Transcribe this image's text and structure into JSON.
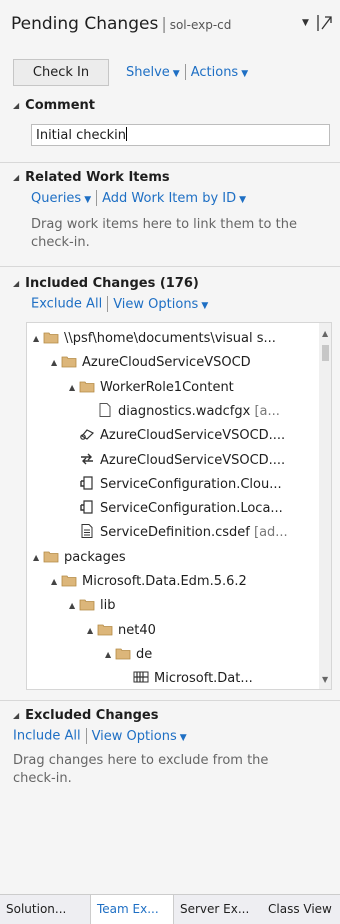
{
  "header": {
    "title": "Pending Changes",
    "separator": "|",
    "workspace": "sol-exp-cd"
  },
  "toolbar": {
    "checkin_label": "Check In",
    "shelve_label": "Shelve",
    "actions_label": "Actions"
  },
  "comment": {
    "heading": "Comment",
    "value": "Initial checkin"
  },
  "related": {
    "heading": "Related Work Items",
    "queries_label": "Queries",
    "add_label": "Add Work Item by ID",
    "help": "Drag work items here to link them to the check-in."
  },
  "included": {
    "heading": "Included Changes (176)",
    "exclude_all_label": "Exclude All",
    "view_options_label": "View Options",
    "tree": [
      {
        "indent": 0,
        "expander": "▲",
        "icon": "folder-icon",
        "label": "\\\\psf\\home\\documents\\visual s...",
        "suffix": ""
      },
      {
        "indent": 1,
        "expander": "▲",
        "icon": "folder-icon",
        "label": "AzureCloudServiceVSOCD",
        "suffix": ""
      },
      {
        "indent": 2,
        "expander": "▲",
        "icon": "folder-icon",
        "label": "WorkerRole1Content",
        "suffix": ""
      },
      {
        "indent": 3,
        "expander": "",
        "icon": "file-icon",
        "label": "diagnostics.wadcfgx",
        "suffix": " [a..."
      },
      {
        "indent": 2,
        "expander": "",
        "icon": "project-icon",
        "label": "AzureCloudServiceVSOCD....",
        "suffix": ""
      },
      {
        "indent": 2,
        "expander": "",
        "icon": "swap-icon",
        "label": "AzureCloudServiceVSOCD....",
        "suffix": ""
      },
      {
        "indent": 2,
        "expander": "",
        "icon": "config-icon",
        "label": "ServiceConfiguration.Clou...",
        "suffix": ""
      },
      {
        "indent": 2,
        "expander": "",
        "icon": "config-icon",
        "label": "ServiceConfiguration.Loca...",
        "suffix": ""
      },
      {
        "indent": 2,
        "expander": "",
        "icon": "document-icon",
        "label": "ServiceDefinition.csdef",
        "suffix": " [ad..."
      },
      {
        "indent": 0,
        "expander": "▲",
        "icon": "folder-icon",
        "label": "packages",
        "suffix": ""
      },
      {
        "indent": 1,
        "expander": "▲",
        "icon": "folder-icon",
        "label": "Microsoft.Data.Edm.5.6.2",
        "suffix": ""
      },
      {
        "indent": 2,
        "expander": "▲",
        "icon": "folder-icon",
        "label": "lib",
        "suffix": ""
      },
      {
        "indent": 3,
        "expander": "▲",
        "icon": "folder-icon",
        "label": "net40",
        "suffix": ""
      },
      {
        "indent": 4,
        "expander": "▲",
        "icon": "folder-icon",
        "label": "de",
        "suffix": ""
      },
      {
        "indent": 5,
        "expander": "",
        "icon": "resource-icon",
        "label": "Microsoft.Dat...",
        "suffix": ""
      }
    ]
  },
  "excluded": {
    "heading": "Excluded Changes",
    "include_all_label": "Include All",
    "view_options_label": "View Options",
    "help": "Drag changes here to exclude from the check-in."
  },
  "tabs": [
    {
      "label": "Solution...",
      "active": false
    },
    {
      "label": "Team Ex...",
      "active": true
    },
    {
      "label": "Server Ex...",
      "active": false
    },
    {
      "label": "Class View",
      "active": false
    }
  ],
  "colors": {
    "link": "#1e6fc4",
    "folder": "#dcb67a",
    "background": "#f5f5f5"
  }
}
